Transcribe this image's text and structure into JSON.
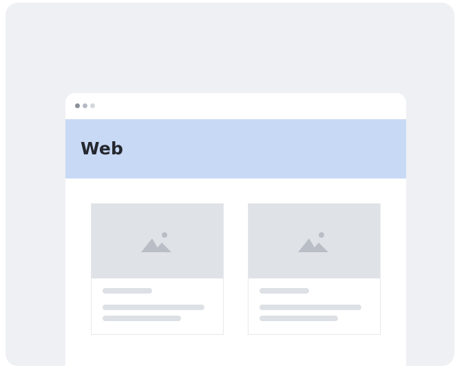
{
  "banner": {
    "title": "Web"
  },
  "browser": {
    "window_dots": [
      "dot-1",
      "dot-2",
      "dot-3"
    ]
  },
  "cards": [
    {
      "image_icon": "image-placeholder-icon"
    },
    {
      "image_icon": "image-placeholder-icon"
    }
  ],
  "colors": {
    "outer_background": "#eef0f3",
    "banner_background": "#c8d9f5",
    "placeholder": "#dfe2e7",
    "skeleton_line": "#dde0e5"
  }
}
